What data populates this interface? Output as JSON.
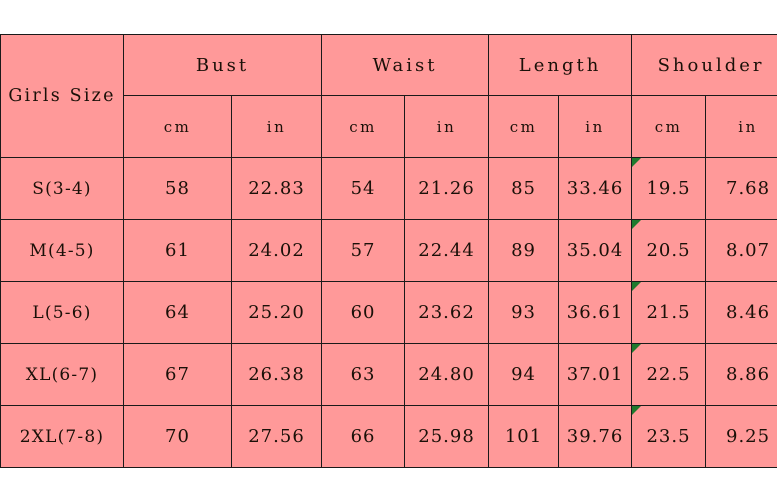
{
  "colors": {
    "cell_pink": "#FF9999",
    "cell_yellow": "#FFC000",
    "border": "#1A1A1A",
    "text": "#1A1008",
    "comment_marker_green": "#1F7A2E",
    "page_background": "#FFFFFF"
  },
  "table": {
    "corner_label": "Girls Size",
    "groups": [
      {
        "label": "Bust"
      },
      {
        "label": "Waist"
      },
      {
        "label": "Length"
      },
      {
        "label": "Shoulder"
      }
    ],
    "units": [
      "cm",
      "in",
      "cm",
      "in",
      "cm",
      "in",
      "cm",
      "in"
    ],
    "rows": [
      {
        "size": "S(3-4)",
        "bust_cm": "58",
        "bust_in": "22.83",
        "waist_cm": "54",
        "waist_in": "21.26",
        "length_cm": "85",
        "length_in": "33.46",
        "shoulder_cm": "19.5",
        "shoulder_in": "7.68"
      },
      {
        "size": "M(4-5)",
        "bust_cm": "61",
        "bust_in": "24.02",
        "waist_cm": "57",
        "waist_in": "22.44",
        "length_cm": "89",
        "length_in": "35.04",
        "shoulder_cm": "20.5",
        "shoulder_in": "8.07"
      },
      {
        "size": "L(5-6)",
        "bust_cm": "64",
        "bust_in": "25.20",
        "waist_cm": "60",
        "waist_in": "23.62",
        "length_cm": "93",
        "length_in": "36.61",
        "shoulder_cm": "21.5",
        "shoulder_in": "8.46"
      },
      {
        "size": "XL(6-7)",
        "bust_cm": "67",
        "bust_in": "26.38",
        "waist_cm": "63",
        "waist_in": "24.80",
        "length_cm": "94",
        "length_in": "37.01",
        "shoulder_cm": "22.5",
        "shoulder_in": "8.86"
      },
      {
        "size": "2XL(7-8)",
        "bust_cm": "70",
        "bust_in": "27.56",
        "waist_cm": "66",
        "waist_in": "25.98",
        "length_cm": "101",
        "length_in": "39.76",
        "shoulder_cm": "23.5",
        "shoulder_in": "9.25"
      }
    ]
  }
}
